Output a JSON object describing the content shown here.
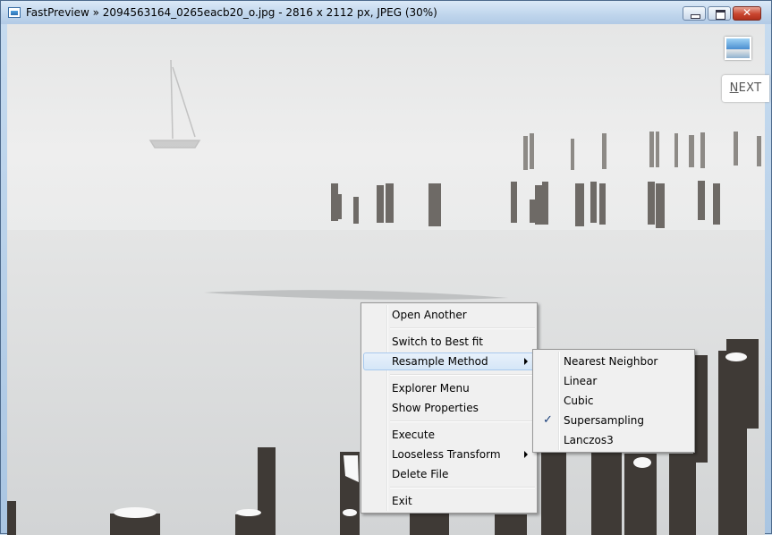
{
  "window": {
    "title": "FastPreview » 2094563164_0265eacb20_o.jpg - 2816 x 2112 px, JPEG (30%)",
    "close_glyph": "✕"
  },
  "viewer": {
    "next_label_first": "N",
    "next_label_rest": "EXT",
    "thumbnail_icon": "image-thumbnail-icon"
  },
  "context_menu": {
    "items": [
      {
        "label": "Open Another"
      },
      {
        "label": "Switch to Best fit"
      },
      {
        "label": "Resample Method",
        "submenu": true,
        "highlighted": true
      },
      {
        "label": "Explorer Menu"
      },
      {
        "label": "Show Properties"
      },
      {
        "label": "Execute"
      },
      {
        "label": "Looseless Transform",
        "submenu": true
      },
      {
        "label": "Delete File"
      },
      {
        "label": "Exit"
      }
    ]
  },
  "resample_menu": {
    "items": [
      {
        "label": "Nearest Neighbor"
      },
      {
        "label": "Linear"
      },
      {
        "label": "Cubic"
      },
      {
        "label": "Supersampling",
        "checked": true
      },
      {
        "label": "Lanczos3"
      }
    ],
    "check_glyph": "✓"
  }
}
